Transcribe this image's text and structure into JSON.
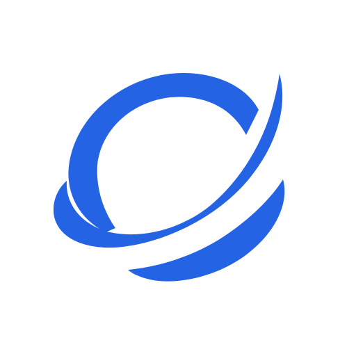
{
  "logo": {
    "icon": "planet-ring-logo-icon",
    "color": "#2563E5",
    "background": "#FFFFFF"
  }
}
